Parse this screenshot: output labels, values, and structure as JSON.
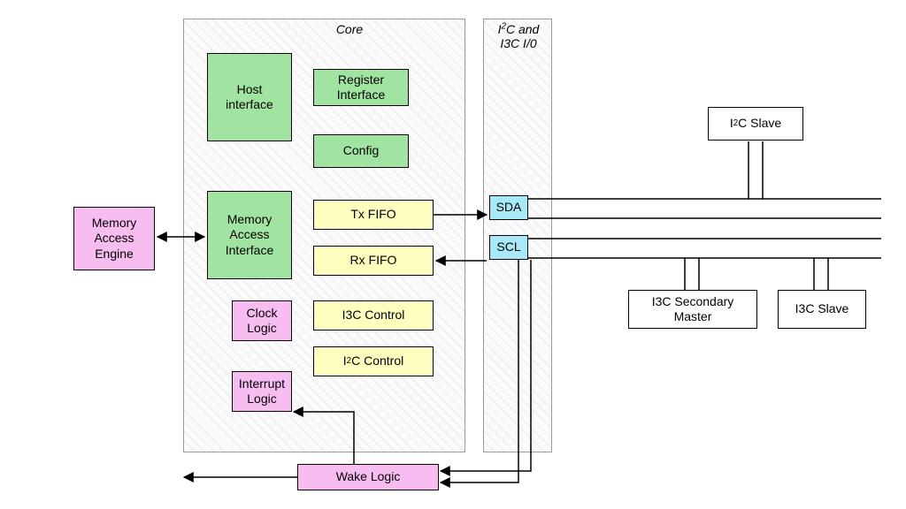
{
  "titles": {
    "core": "Core",
    "io": "I²C and\nI3C I/0"
  },
  "blocks": {
    "memory_access_engine": "Memory\nAccess\nEngine",
    "host_interface": "Host\ninterface",
    "memory_access_interface": "Memory\nAccess\nInterface",
    "register_interface": "Register\nInterface",
    "config": "Config",
    "tx_fifo": "Tx FIFO",
    "rx_fifo": "Rx FIFO",
    "i3c_control": "I3C Control",
    "i2c_control": "I²C Control",
    "clock_logic": "Clock\nLogic",
    "interrupt_logic": "Interrupt\nLogic",
    "wake_logic": "Wake Logic",
    "sda": "SDA",
    "scl": "SCL",
    "i2c_slave": "I²C Slave",
    "i3c_secondary_master": "I3C Secondary\nMaster",
    "i3c_slave": "I3C Slave"
  }
}
